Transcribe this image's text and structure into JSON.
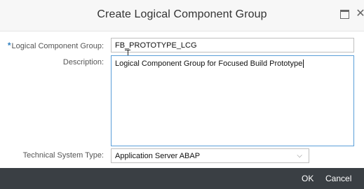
{
  "dialog": {
    "title": "Create Logical Component Group",
    "close_glyph": "✕"
  },
  "form": {
    "required_marker": "*",
    "lcg_label": "Logical Component Group:",
    "lcg_value": "FB_PROTOTYPE_LCG",
    "description_label": "Description:",
    "description_value": "Logical Component Group for Focused Build Prototype",
    "system_type_label": "Technical System Type:",
    "system_type_value": "Application Server ABAP"
  },
  "footer": {
    "ok_label": "OK",
    "cancel_label": "Cancel"
  },
  "icons": {
    "maximize": "maximize-icon",
    "close": "close-icon",
    "dropdown": "chevron-down-icon",
    "mouse": "text-cursor-icon"
  },
  "colors": {
    "footer_bg": "#3a3f44",
    "required_marker": "#2f7fbf",
    "focus_border": "#5a9ed8"
  }
}
